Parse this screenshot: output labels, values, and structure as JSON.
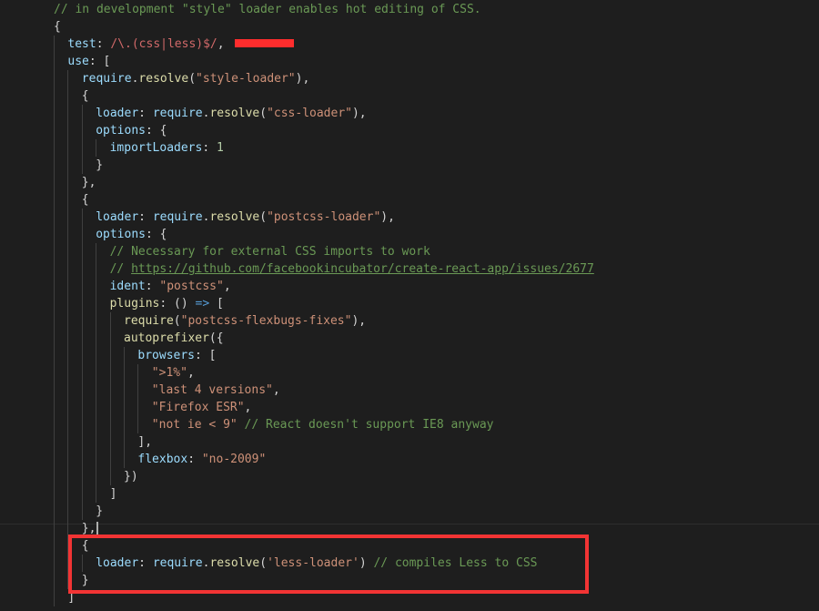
{
  "editor": {
    "lines": [
      {
        "indent": 0,
        "tokens": [
          {
            "t": "com",
            "v": "// in development \"style\" loader enables hot editing of CSS."
          }
        ]
      },
      {
        "indent": 0,
        "tokens": [
          {
            "t": "punc",
            "v": "{"
          }
        ]
      },
      {
        "indent": 1,
        "tokens": [
          {
            "t": "key",
            "v": "test"
          },
          {
            "t": "punc",
            "v": ": "
          },
          {
            "t": "regex",
            "v": "/\\.(css|less)$/"
          },
          {
            "t": "punc",
            "v": ","
          }
        ]
      },
      {
        "indent": 1,
        "tokens": [
          {
            "t": "key",
            "v": "use"
          },
          {
            "t": "punc",
            "v": ": ["
          }
        ]
      },
      {
        "indent": 2,
        "tokens": [
          {
            "t": "key",
            "v": "require"
          },
          {
            "t": "punc",
            "v": "."
          },
          {
            "t": "fn",
            "v": "resolve"
          },
          {
            "t": "punc",
            "v": "("
          },
          {
            "t": "str",
            "v": "\"style-loader\""
          },
          {
            "t": "punc",
            "v": "),"
          }
        ]
      },
      {
        "indent": 2,
        "tokens": [
          {
            "t": "punc",
            "v": "{"
          }
        ]
      },
      {
        "indent": 3,
        "tokens": [
          {
            "t": "key",
            "v": "loader"
          },
          {
            "t": "punc",
            "v": ": "
          },
          {
            "t": "key",
            "v": "require"
          },
          {
            "t": "punc",
            "v": "."
          },
          {
            "t": "fn",
            "v": "resolve"
          },
          {
            "t": "punc",
            "v": "("
          },
          {
            "t": "str",
            "v": "\"css-loader\""
          },
          {
            "t": "punc",
            "v": "),"
          }
        ]
      },
      {
        "indent": 3,
        "tokens": [
          {
            "t": "key",
            "v": "options"
          },
          {
            "t": "punc",
            "v": ": {"
          }
        ]
      },
      {
        "indent": 4,
        "tokens": [
          {
            "t": "key",
            "v": "importLoaders"
          },
          {
            "t": "punc",
            "v": ": "
          },
          {
            "t": "num",
            "v": "1"
          }
        ]
      },
      {
        "indent": 3,
        "tokens": [
          {
            "t": "punc",
            "v": "}"
          }
        ]
      },
      {
        "indent": 2,
        "tokens": [
          {
            "t": "punc",
            "v": "},"
          }
        ]
      },
      {
        "indent": 2,
        "tokens": [
          {
            "t": "punc",
            "v": "{"
          }
        ]
      },
      {
        "indent": 3,
        "tokens": [
          {
            "t": "key",
            "v": "loader"
          },
          {
            "t": "punc",
            "v": ": "
          },
          {
            "t": "key",
            "v": "require"
          },
          {
            "t": "punc",
            "v": "."
          },
          {
            "t": "fn",
            "v": "resolve"
          },
          {
            "t": "punc",
            "v": "("
          },
          {
            "t": "str",
            "v": "\"postcss-loader\""
          },
          {
            "t": "punc",
            "v": "),"
          }
        ]
      },
      {
        "indent": 3,
        "tokens": [
          {
            "t": "key",
            "v": "options"
          },
          {
            "t": "punc",
            "v": ": {"
          }
        ]
      },
      {
        "indent": 4,
        "tokens": [
          {
            "t": "com",
            "v": "// Necessary for external CSS imports to work"
          }
        ]
      },
      {
        "indent": 4,
        "tokens": [
          {
            "t": "com",
            "v": "// "
          },
          {
            "t": "link",
            "v": "https://github.com/facebookincubator/create-react-app/issues/2677"
          }
        ]
      },
      {
        "indent": 4,
        "tokens": [
          {
            "t": "key",
            "v": "ident"
          },
          {
            "t": "punc",
            "v": ": "
          },
          {
            "t": "str",
            "v": "\"postcss\""
          },
          {
            "t": "punc",
            "v": ","
          }
        ]
      },
      {
        "indent": 4,
        "tokens": [
          {
            "t": "fn",
            "v": "plugins"
          },
          {
            "t": "punc",
            "v": ": () "
          },
          {
            "t": "kw",
            "v": "=>"
          },
          {
            "t": "punc",
            "v": " ["
          }
        ]
      },
      {
        "indent": 5,
        "tokens": [
          {
            "t": "fn",
            "v": "require"
          },
          {
            "t": "punc",
            "v": "("
          },
          {
            "t": "str",
            "v": "\"postcss-flexbugs-fixes\""
          },
          {
            "t": "punc",
            "v": "),"
          }
        ]
      },
      {
        "indent": 5,
        "tokens": [
          {
            "t": "fn",
            "v": "autoprefixer"
          },
          {
            "t": "punc",
            "v": "({"
          }
        ]
      },
      {
        "indent": 6,
        "tokens": [
          {
            "t": "key",
            "v": "browsers"
          },
          {
            "t": "punc",
            "v": ": ["
          }
        ]
      },
      {
        "indent": 7,
        "tokens": [
          {
            "t": "str",
            "v": "\">1%\""
          },
          {
            "t": "punc",
            "v": ","
          }
        ]
      },
      {
        "indent": 7,
        "tokens": [
          {
            "t": "str",
            "v": "\"last 4 versions\""
          },
          {
            "t": "punc",
            "v": ","
          }
        ]
      },
      {
        "indent": 7,
        "tokens": [
          {
            "t": "str",
            "v": "\"Firefox ESR\""
          },
          {
            "t": "punc",
            "v": ","
          }
        ]
      },
      {
        "indent": 7,
        "tokens": [
          {
            "t": "str",
            "v": "\"not ie < 9\""
          },
          {
            "t": "punc",
            "v": " "
          },
          {
            "t": "com",
            "v": "// React doesn't support IE8 anyway"
          }
        ]
      },
      {
        "indent": 6,
        "tokens": [
          {
            "t": "punc",
            "v": "],"
          }
        ]
      },
      {
        "indent": 6,
        "tokens": [
          {
            "t": "key",
            "v": "flexbox"
          },
          {
            "t": "punc",
            "v": ": "
          },
          {
            "t": "str",
            "v": "\"no-2009\""
          }
        ]
      },
      {
        "indent": 5,
        "tokens": [
          {
            "t": "punc",
            "v": "})"
          }
        ]
      },
      {
        "indent": 4,
        "tokens": [
          {
            "t": "punc",
            "v": "]"
          }
        ]
      },
      {
        "indent": 3,
        "tokens": [
          {
            "t": "punc",
            "v": "}"
          }
        ]
      },
      {
        "indent": 2,
        "tokens": [
          {
            "t": "punc",
            "v": "},"
          }
        ],
        "cursor": true
      },
      {
        "indent": 2,
        "tokens": [
          {
            "t": "punc",
            "v": "{"
          }
        ]
      },
      {
        "indent": 3,
        "tokens": [
          {
            "t": "key",
            "v": "loader"
          },
          {
            "t": "punc",
            "v": ": "
          },
          {
            "t": "key",
            "v": "require"
          },
          {
            "t": "punc",
            "v": "."
          },
          {
            "t": "fn",
            "v": "resolve"
          },
          {
            "t": "punc",
            "v": "("
          },
          {
            "t": "str",
            "v": "'less-loader'"
          },
          {
            "t": "punc",
            "v": ") "
          },
          {
            "t": "com",
            "v": "// compiles Less to CSS"
          }
        ]
      },
      {
        "indent": 2,
        "tokens": [
          {
            "t": "punc",
            "v": "}"
          }
        ]
      },
      {
        "indent": 1,
        "tokens": [
          {
            "t": "punc",
            "v": "]"
          }
        ]
      }
    ]
  },
  "annotations": {
    "highlight_box_color": "#f23434",
    "redaction_color": "#ff2d2d"
  }
}
